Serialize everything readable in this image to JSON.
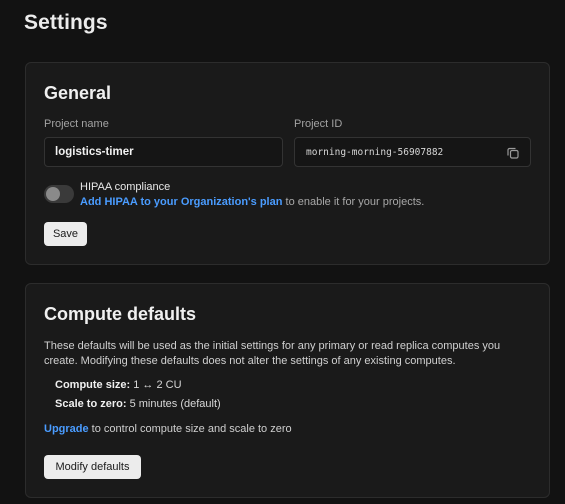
{
  "page": {
    "title": "Settings"
  },
  "general": {
    "title": "General",
    "project_name_label": "Project name",
    "project_name_value": "logistics-timer",
    "project_id_label": "Project ID",
    "project_id_value": "morning-morning-56907882",
    "hipaa": {
      "enabled": false,
      "title": "HIPAA compliance",
      "link_text": "Add HIPAA to your Organization's plan",
      "suffix_text": " to enable it for your projects."
    },
    "save_label": "Save"
  },
  "compute": {
    "title": "Compute defaults",
    "description": "These defaults will be used as the initial settings for any primary or read replica computes you create. Modifying these defaults does not alter the settings of any existing computes.",
    "size_label": "Compute size:",
    "size_value": " 1 ↔ 2 CU",
    "scale_label": "Scale to zero:",
    "scale_value": " 5 minutes (default)",
    "upgrade_link": "Upgrade",
    "upgrade_text": " to control compute size and scale to zero",
    "modify_label": "Modify defaults"
  },
  "colors": {
    "background": "#121212",
    "card": "#1a1a1a",
    "link": "#4a9cff",
    "button": "#ececec"
  },
  "icons": {
    "copy": "copy-icon"
  }
}
